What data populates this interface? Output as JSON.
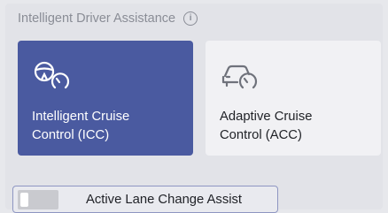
{
  "section": {
    "title": "Intelligent Driver Assistance",
    "info_icon": "info-icon"
  },
  "cards": {
    "icc": {
      "label": "Intelligent Cruise\nControl (ICC)",
      "icon": "steering-wheel-speedometer-icon",
      "selected": true
    },
    "acc": {
      "label": "Adaptive Cruise\nControl (ACC)",
      "icon": "car-speedometer-icon",
      "selected": false
    }
  },
  "toggle": {
    "label": "Active Lane Change Assist",
    "state": "off"
  },
  "colors": {
    "selected": "#4a5aa0",
    "unselected": "#f1f1f4",
    "background": "#e2e3e8"
  }
}
